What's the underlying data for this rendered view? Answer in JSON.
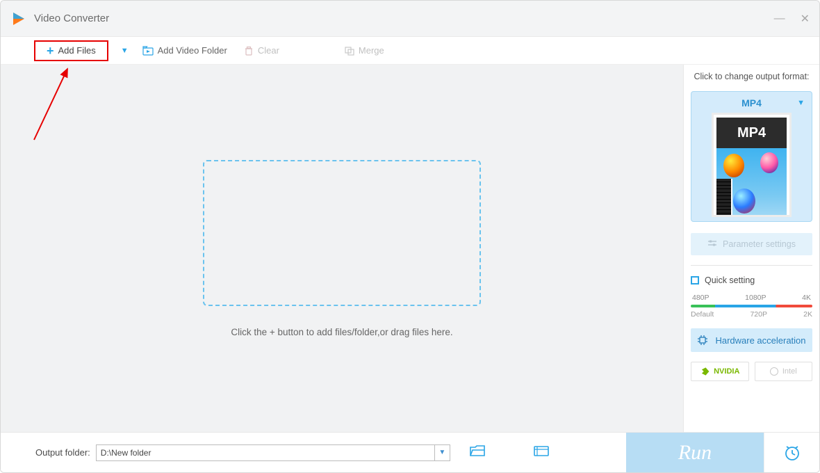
{
  "titlebar": {
    "app_title": "Video Converter"
  },
  "toolbar": {
    "add_files": "Add Files",
    "add_folder": "Add Video Folder",
    "clear": "Clear",
    "merge": "Merge"
  },
  "drop_area": {
    "caption": "Click the + button to add files/folder,or drag files here."
  },
  "right_panel": {
    "caption": "Click to change output format:",
    "format_label": "MP4",
    "thumb_badge": "MP4",
    "parameter_settings": "Parameter settings",
    "quick_setting": "Quick setting",
    "slider_top_labels": [
      "480P",
      "1080P",
      "4K"
    ],
    "slider_bottom_labels": [
      "Default",
      "720P",
      "2K"
    ],
    "hardware_acceleration": "Hardware acceleration",
    "gpu_nvidia": "NVIDIA",
    "gpu_intel": "Intel"
  },
  "bottombar": {
    "output_folder_label": "Output folder:",
    "output_folder_value": "D:\\New folder",
    "run": "Run"
  }
}
